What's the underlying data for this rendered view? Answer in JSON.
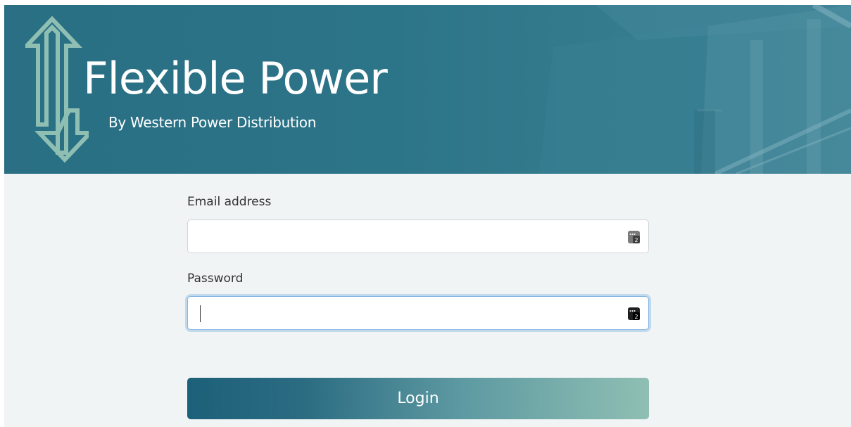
{
  "brand": {
    "title": "Flexible Power",
    "subtitle": "By Western Power Distribution",
    "logo_icon": "up-down-arrows-icon"
  },
  "form": {
    "email": {
      "label": "Email address",
      "value": "",
      "placeholder": ""
    },
    "password": {
      "label": "Password",
      "value": "",
      "placeholder": ""
    },
    "password_manager_icon": "password-manager-key-icon",
    "login_label": "Login"
  },
  "colors": {
    "banner": "#2c7488",
    "page_bg": "#f1f4f4",
    "button_start": "#1c6079",
    "button_end": "#8fbfb3",
    "focus_ring": "#86b7e2"
  }
}
